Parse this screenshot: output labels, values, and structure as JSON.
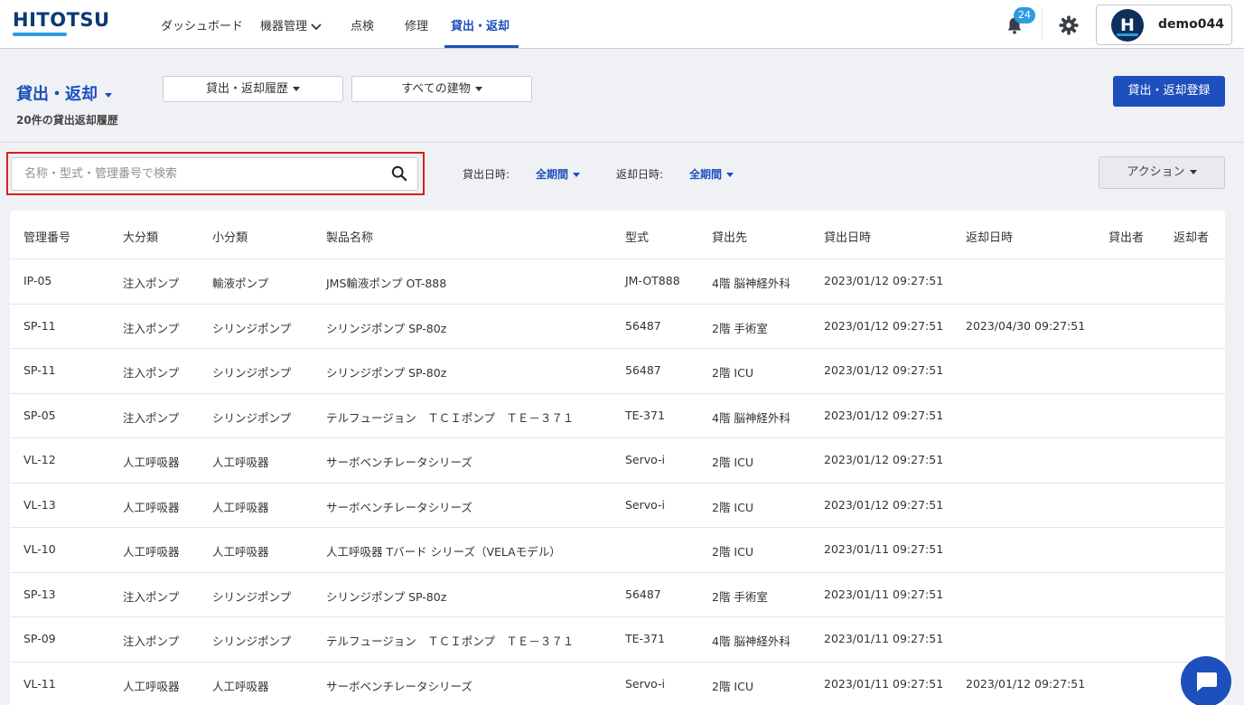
{
  "app": {
    "logo_text": "HITOTSU"
  },
  "nav": {
    "items": [
      {
        "label": "ダッシュボード"
      },
      {
        "label": "機器管理"
      },
      {
        "label": "点検"
      },
      {
        "label": "修理"
      },
      {
        "label": "貸出・返却"
      }
    ],
    "active": "貸出・返却"
  },
  "header": {
    "notification_count": "24",
    "user_initial": "H",
    "user_name": "demo044"
  },
  "page": {
    "title": "貸出・返却",
    "subtitle": "20件の貸出返却履歴",
    "history_dropdown": "貸出・返却履歴",
    "building_dropdown": "すべての建物",
    "register_button": "貸出・返却登録"
  },
  "filters": {
    "search_placeholder": "名称・型式・管理番号で検索",
    "lend_date_label": "貸出日時:",
    "lend_date_value": "全期間",
    "return_date_label": "返却日時:",
    "return_date_value": "全期間",
    "action_button": "アクション"
  },
  "table": {
    "headers": [
      "管理番号",
      "大分類",
      "小分類",
      "製品名称",
      "型式",
      "貸出先",
      "貸出日時",
      "返却日時",
      "貸出者",
      "返却者"
    ],
    "rows": [
      [
        "IP-05",
        "注入ポンプ",
        "輸液ポンプ",
        "JMS輸液ポンプ OT-888",
        "JM-OT888",
        "4階 脳神経外科",
        "2023/01/12 09:27:51",
        "",
        "",
        ""
      ],
      [
        "SP-11",
        "注入ポンプ",
        "シリンジポンプ",
        "シリンジポンプ SP-80z",
        "56487",
        "2階 手術室",
        "2023/01/12 09:27:51",
        "2023/04/30 09:27:51",
        "",
        ""
      ],
      [
        "SP-11",
        "注入ポンプ",
        "シリンジポンプ",
        "シリンジポンプ SP-80z",
        "56487",
        "2階 ICU",
        "2023/01/12 09:27:51",
        "",
        "",
        ""
      ],
      [
        "SP-05",
        "注入ポンプ",
        "シリンジポンプ",
        "テルフュージョン　ＴＣＩポンプ　ＴＥ－３７１",
        "TE-371",
        "4階 脳神経外科",
        "2023/01/12 09:27:51",
        "",
        "",
        ""
      ],
      [
        "VL-12",
        "人工呼吸器",
        "人工呼吸器",
        "サーボベンチレータシリーズ",
        "Servo-i",
        "2階 ICU",
        "2023/01/12 09:27:51",
        "",
        "",
        ""
      ],
      [
        "VL-13",
        "人工呼吸器",
        "人工呼吸器",
        "サーボベンチレータシリーズ",
        "Servo-i",
        "2階 ICU",
        "2023/01/12 09:27:51",
        "",
        "",
        ""
      ],
      [
        "VL-10",
        "人工呼吸器",
        "人工呼吸器",
        "人工呼吸器 Tバード シリーズ（VELAモデル）",
        "",
        "2階 ICU",
        "2023/01/11 09:27:51",
        "",
        "",
        ""
      ],
      [
        "SP-13",
        "注入ポンプ",
        "シリンジポンプ",
        "シリンジポンプ SP-80z",
        "56487",
        "2階 手術室",
        "2023/01/11 09:27:51",
        "",
        "",
        ""
      ],
      [
        "SP-09",
        "注入ポンプ",
        "シリンジポンプ",
        "テルフュージョン　ＴＣＩポンプ　ＴＥ－３７１",
        "TE-371",
        "4階 脳神経外科",
        "2023/01/11 09:27:51",
        "",
        "",
        ""
      ],
      [
        "VL-11",
        "人工呼吸器",
        "人工呼吸器",
        "サーボベンチレータシリーズ",
        "Servo-i",
        "2階 ICU",
        "2023/01/11 09:27:51",
        "2023/01/12 09:27:51",
        "",
        ""
      ]
    ]
  },
  "colors": {
    "brand": "#1d4fbd",
    "accent": "#2d9ce0",
    "highlight_border": "#d61f1f"
  },
  "icons": [
    "bell-icon",
    "gear-icon",
    "search-icon",
    "chevron-down-icon",
    "chat-icon"
  ]
}
